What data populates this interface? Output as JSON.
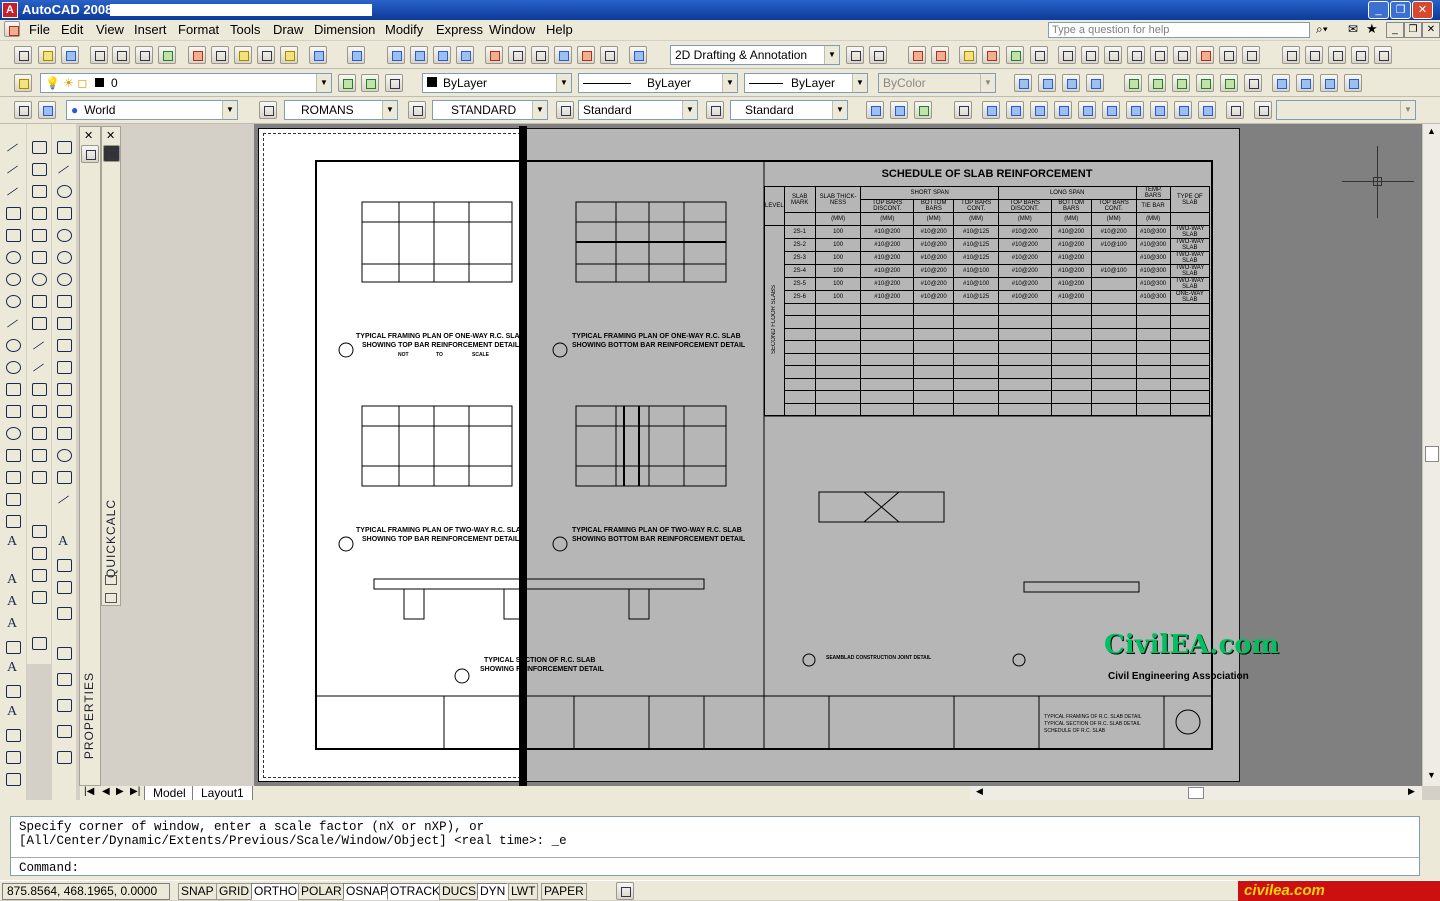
{
  "app": {
    "title": "AutoCAD 2008 -"
  },
  "menu": [
    "File",
    "Edit",
    "View",
    "Insert",
    "Format",
    "Tools",
    "Draw",
    "Dimension",
    "Modify",
    "Express",
    "Window",
    "Help"
  ],
  "help": {
    "placeholder": "Type a question for help"
  },
  "toolbar": {
    "workspace": "2D Drafting & Annotation",
    "layer": "0",
    "color": "ByLayer",
    "linetype": "ByLayer",
    "lineweight": "ByLayer",
    "plotstyle": "ByColor",
    "ucs": "World",
    "textstyle": "ROMANS",
    "dimstyle": "STANDARD",
    "tablestyle": "Standard",
    "mleaderstyle": "Standard"
  },
  "palettes": {
    "quickcalc": "QUICKCALC",
    "properties": "PROPERTIES"
  },
  "drawing": {
    "schedule_title": "SCHEDULE OF SLAB REINFORCEMENT",
    "group_short": "SHORT SPAN",
    "group_long": "LONG SPAN",
    "group_temp": "TEMP. BARS",
    "headers": [
      "SLAB MARK",
      "SLAB THICK-NESS",
      "TOP BARS DISCONT.",
      "BOTTOM BARS",
      "TOP BARS CONT.",
      "TOP BARS DISCONT.",
      "BOTTOM BARS",
      "TOP BARS CONT.",
      "TIE BAR",
      "TYPE OF SLAB"
    ],
    "units": [
      "",
      "(MM)",
      "(MM)",
      "(MM)",
      "(MM)",
      "(MM)",
      "(MM)",
      "(MM)",
      "(MM)",
      ""
    ],
    "level_label": "LEVEL",
    "floor_label": "SECOND FLOOR SLABS",
    "rows": [
      [
        "2S-1",
        "100",
        "#10@200",
        "#10@200",
        "#10@125",
        "#10@200",
        "#10@200",
        "#10@200",
        "#10@300",
        "TWO-WAY SLAB"
      ],
      [
        "2S-2",
        "100",
        "#10@200",
        "#10@200",
        "#10@125",
        "#10@200",
        "#10@200",
        "#10@100",
        "#10@300",
        "TWO-WAY SLAB"
      ],
      [
        "2S-3",
        "100",
        "#10@200",
        "#10@200",
        "#10@125",
        "#10@200",
        "#10@200",
        "",
        "#10@300",
        "TWO-WAY SLAB"
      ],
      [
        "2S-4",
        "100",
        "#10@200",
        "#10@200",
        "#10@100",
        "#10@200",
        "#10@200",
        "#10@100",
        "#10@300",
        "TWO-WAY SLAB"
      ],
      [
        "2S-5",
        "100",
        "#10@200",
        "#10@200",
        "#10@100",
        "#10@200",
        "#10@200",
        "",
        "#10@300",
        "TWO-WAY SLAB"
      ],
      [
        "2S-6",
        "100",
        "#10@200",
        "#10@200",
        "#10@125",
        "#10@200",
        "#10@200",
        "",
        "#10@300",
        "ONE-WAY SLAB"
      ]
    ],
    "captions": [
      "TYPICAL FRAMING PLAN OF ONE-WAY R.C. SLAB",
      "SHOWING TOP BAR REINFORCEMENT DETAIL",
      "TYPICAL FRAMING PLAN OF ONE-WAY R.C. SLAB",
      "SHOWING BOTTOM BAR REINFORCEMENT DETAIL",
      "TYPICAL FRAMING PLAN OF TWO-WAY R.C. SLAB",
      "SHOWING TOP BAR REINFORCEMENT DETAIL",
      "TYPICAL FRAMING PLAN OF TWO-WAY R.C. SLAB",
      "SHOWING BOTTOM BAR REINFORCEMENT DETAIL",
      "TYPICAL SECTION OF R.C. SLAB",
      "SHOWING REINFORCEMENT DETAIL"
    ],
    "scale_labels": [
      "NOT",
      "TO",
      "SCALE"
    ],
    "joint_caption": "SEAMBLAD CONSTRUCTION JOINT DETAIL",
    "title_block": [
      "TYPICAL FRAMING OF R.C. SLAB DETAIL",
      "TYPICAL SECTION OF R.C. SLAB DETAIL",
      "SCHEDULE OF R.C. SLAB"
    ]
  },
  "watermark": {
    "brand": "CivilEA.com",
    "tagline": "Civil Engineering Association",
    "corner": "civilea.com"
  },
  "tabs": [
    "Model",
    "Layout1"
  ],
  "command": {
    "line1": "Specify corner of window, enter a scale factor (nX or nXP), or",
    "line2": "[All/Center/Dynamic/Extents/Previous/Scale/Window/Object] <real time>: _e",
    "prompt": "Command:"
  },
  "status": {
    "coords": "875.8564, 468.1965, 0.0000",
    "buttons": [
      "SNAP",
      "GRID",
      "ORTHO",
      "POLAR",
      "OSNAP",
      "OTRACK",
      "DUCS",
      "DYN",
      "LWT",
      "PAPER"
    ]
  }
}
